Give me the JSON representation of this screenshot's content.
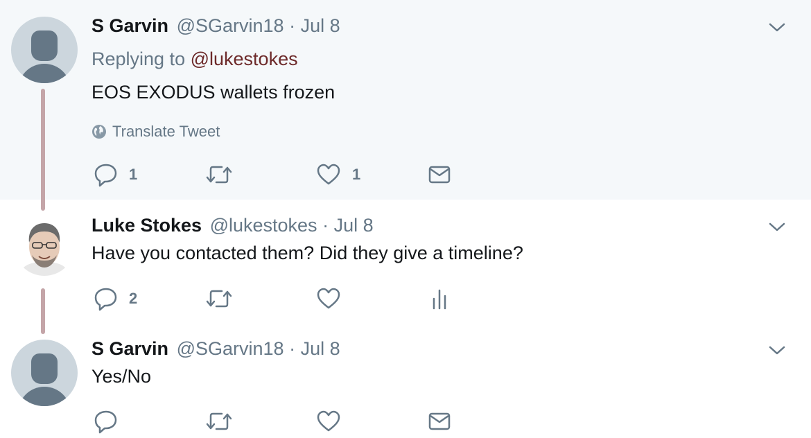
{
  "tweets": [
    {
      "name": "S Garvin",
      "handle": "@SGarvin18",
      "separator": "·",
      "date": "Jul 8",
      "replying_prefix": "Replying to",
      "replying_to": "@lukestokes",
      "text": "EOS EXODUS wallets frozen",
      "translate_label": "Translate Tweet",
      "reply_count": "1",
      "like_count": "1"
    },
    {
      "name": "Luke Stokes",
      "handle": "@lukestokes",
      "separator": "·",
      "date": "Jul 8",
      "text": "Have you contacted them? Did they give a timeline?",
      "reply_count": "2"
    },
    {
      "name": "S Garvin",
      "handle": "@SGarvin18",
      "separator": "·",
      "date": "Jul 8",
      "text": "Yes/No"
    }
  ],
  "icons": {
    "reply": "reply-icon",
    "retweet": "retweet-icon",
    "like": "heart-icon",
    "dm": "envelope-icon",
    "analytics": "analytics-icon",
    "caret": "chevron-down-icon",
    "globe": "globe-icon"
  },
  "colors": {
    "background_highlight": "#f5f8fa",
    "secondary_text": "#657786",
    "thread_line": "#c4a5a8",
    "mention": "#6d2a2a"
  }
}
